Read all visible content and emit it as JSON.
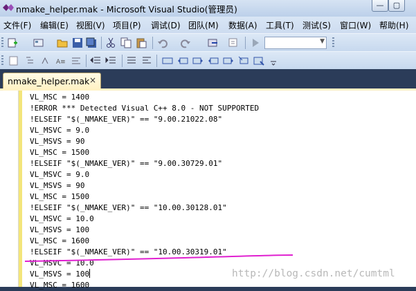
{
  "window": {
    "title": "nmake_helper.mak - Microsoft Visual Studio(管理员)",
    "buttons": [
      {
        "label": "—"
      },
      {
        "label": "▢"
      }
    ]
  },
  "menu": [
    {
      "label": "文件(F)"
    },
    {
      "label": "编辑(E)"
    },
    {
      "label": "视图(V)"
    },
    {
      "label": "项目(P)"
    },
    {
      "label": "调试(D)"
    },
    {
      "label": "团队(M)"
    },
    {
      "label": "数据(A)"
    },
    {
      "label": "工具(T)"
    },
    {
      "label": "测试(S)"
    },
    {
      "label": "窗口(W)"
    },
    {
      "label": "帮助(H)"
    }
  ],
  "toolbar1": {
    "icons": [
      "add-item-icon",
      "new-project-icon",
      "open-file-icon",
      "save-icon",
      "save-all-icon",
      "cut-icon",
      "copy-icon",
      "paste-icon",
      "undo-icon",
      "redo-icon",
      "navigate-icon",
      "find-icon",
      "start-debug-icon"
    ],
    "config_combo": {
      "value": ""
    }
  },
  "toolbar2": {
    "icons": [
      "format-icon",
      "outline-icon",
      "members-icon",
      "quick-info-icon",
      "param-info-icon",
      "indent-decrease-icon",
      "indent-increase-icon",
      "comment-icon",
      "uncomment-icon",
      "bookmark-icon",
      "bookmark-prev-icon",
      "bookmark-next-icon",
      "bookmark-prev-folder-icon",
      "bookmark-next-folder-icon",
      "bookmark-clear-icon",
      "bookmark-window-icon"
    ]
  },
  "tab": {
    "label": "nmake_helper.mak",
    "close": "×"
  },
  "code_lines": [
    "VL_MSC = 1400",
    "!ERROR *** Detected Visual C++ 8.0 - NOT SUPPORTED",
    "!ELSEIF \"$(_NMAKE_VER)\" == \"9.00.21022.08\"",
    "VL_MSVC = 9.0",
    "VL_MSVS = 90",
    "VL_MSC = 1500",
    "!ELSEIF \"$(_NMAKE_VER)\" == \"9.00.30729.01\"",
    "VL_MSVC = 9.0",
    "VL_MSVS = 90",
    "VL_MSC = 1500",
    "!ELSEIF \"$(_NMAKE_VER)\" == \"10.00.30128.01\"",
    "VL_MSVC = 10.0",
    "VL_MSVS = 100",
    "VL_MSC = 1600",
    "!ELSEIF \"$(_NMAKE_VER)\" == \"10.00.30319.01\"",
    "VL_MSVC = 10.0",
    "VL_MSVS = 100",
    "VL_MSC = 1600"
  ],
  "watermark": "http://blog.csdn.net/cumtml",
  "colors": {
    "highlight_stroke": "#e020d0",
    "tab_active": "#fff2c4",
    "window_bg": "#2b3c59"
  }
}
